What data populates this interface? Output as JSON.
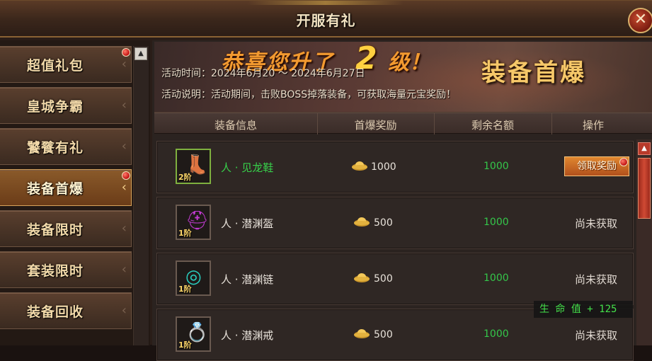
{
  "window": {
    "title": "开服有礼",
    "close_label": "✕"
  },
  "sidebar": {
    "items": [
      {
        "label": "超值礼包",
        "active": false,
        "badge": true
      },
      {
        "label": "皇城争霸",
        "active": false,
        "badge": false
      },
      {
        "label": "饕餮有礼",
        "active": false,
        "badge": false
      },
      {
        "label": "装备首爆",
        "active": true,
        "badge": true
      },
      {
        "label": "装备限时",
        "active": false,
        "badge": false
      },
      {
        "label": "套装限时",
        "active": false,
        "badge": false
      },
      {
        "label": "装备回收",
        "active": false,
        "badge": false
      }
    ]
  },
  "banner": {
    "congrats_prefix": "恭喜您升了",
    "congrats_level": "2",
    "congrats_suffix": "级！",
    "title": "装备首爆",
    "time_text": "活动时间：2024年6月20 ～ 2024年6月27日",
    "desc_text": "活动说明：活动期间，击败BOSS掉落装备，可获取海量元宝奖励！"
  },
  "table": {
    "headers": [
      "装备信息",
      "首爆奖励",
      "剩余名额",
      "操作"
    ],
    "rows": [
      {
        "icon": "boots-icon",
        "tier": "2阶",
        "name": "人 · 见龙鞋",
        "reward": "1000",
        "remaining": "1000",
        "action": "领取奖励",
        "claimable": true,
        "badge": true
      },
      {
        "icon": "helmet-icon",
        "tier": "1阶",
        "name": "人 · 潜渊盔",
        "reward": "500",
        "remaining": "1000",
        "action": "尚未获取",
        "claimable": false
      },
      {
        "icon": "necklace-icon",
        "tier": "1阶",
        "name": "人 · 潜渊链",
        "reward": "500",
        "remaining": "1000",
        "action": "尚未获取",
        "claimable": false
      },
      {
        "icon": "ring-icon",
        "tier": "1阶",
        "name": "人 · 潜渊戒",
        "reward": "500",
        "remaining": "1000",
        "action": "尚未获取",
        "claimable": false
      }
    ]
  },
  "notification": {
    "text": "生 命 值 + 125"
  },
  "colors": {
    "accent": "#f6c869",
    "claim_button": "#d06a24",
    "remaining": "#34c64a",
    "highlight_name": "#37d04a"
  }
}
